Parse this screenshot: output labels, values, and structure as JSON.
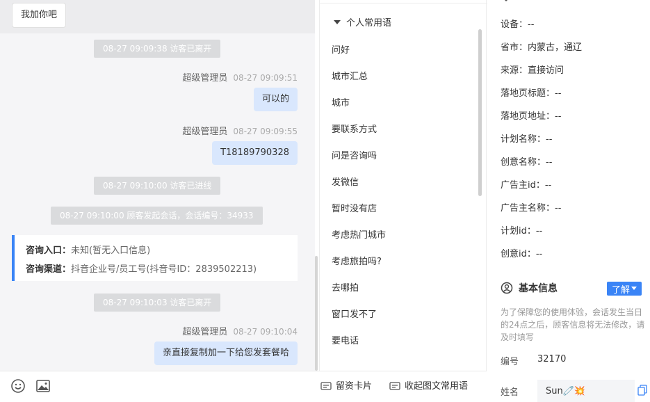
{
  "chat": {
    "visitor_bubble": "我加你吧",
    "system_left": "08-27 09:09:38 访客已离开",
    "msg1_sender": "超级管理员",
    "msg1_time": "08-27 09:09:51",
    "msg1_text": "可以的",
    "msg2_sender": "超级管理员",
    "msg2_time": "08-27 09:09:55",
    "msg2_text": "T18189790328",
    "system_online": "08-27 09:10:00 访客已进线",
    "system_session": "08-27 09:10:00 顾客发起会话，会话编号：34933",
    "info_card": {
      "entry_label": "咨询入口：",
      "entry_value": "未知(暂无入口信息)",
      "channel_label": "咨询渠道：",
      "channel_value": "抖音企业号/员工号(抖音号ID：2839502213)"
    },
    "system_left2": "08-27 09:10:03 访客已离开",
    "msg3_sender": "超级管理员",
    "msg3_time": "08-27 09:10:04",
    "msg3_text": "亲直接复制加一下给您发套餐哈"
  },
  "toolbar": {
    "emoji_icon": "smile-icon",
    "image_icon": "image-icon",
    "card_label": "留资卡片",
    "collapse_label": "收起图文常用语"
  },
  "phrases": {
    "header": "个人常用语",
    "items": [
      "问好",
      "城市汇总",
      "城市",
      "要联系方式",
      "问是咨询吗",
      "发微信",
      "暂时没有店",
      "考虑热门城市",
      "考虑旅拍吗?",
      "去哪拍",
      "窗口发不了",
      "要电话"
    ]
  },
  "details": {
    "device": "设备：--",
    "region": "省市：内蒙古，通辽",
    "source": "来源：直接访问",
    "landing_title": "落地页标题：--",
    "landing_url": "落地页地址：--",
    "plan_name": "计划名称：--",
    "creative_name": "创意名称：--",
    "advertiser_id": "广告主id：--",
    "advertiser_name": "广告主名称：--",
    "plan_id": "计划id：--",
    "creative_id": "创意id：--"
  },
  "basic": {
    "title": "基本信息",
    "learn_more": "了解",
    "notice": "为了保障您的使用体验，会话发生当日的24点之后，顾客信息将无法修改，请及时填写",
    "number_label": "编号",
    "number_value": "32170",
    "name_label": "姓名",
    "name_value": "Sun🧷💥"
  },
  "colors": {
    "accent": "#3a84f6",
    "agent_bubble": "#d9e7fd",
    "system_pill": "#dadbdd"
  }
}
